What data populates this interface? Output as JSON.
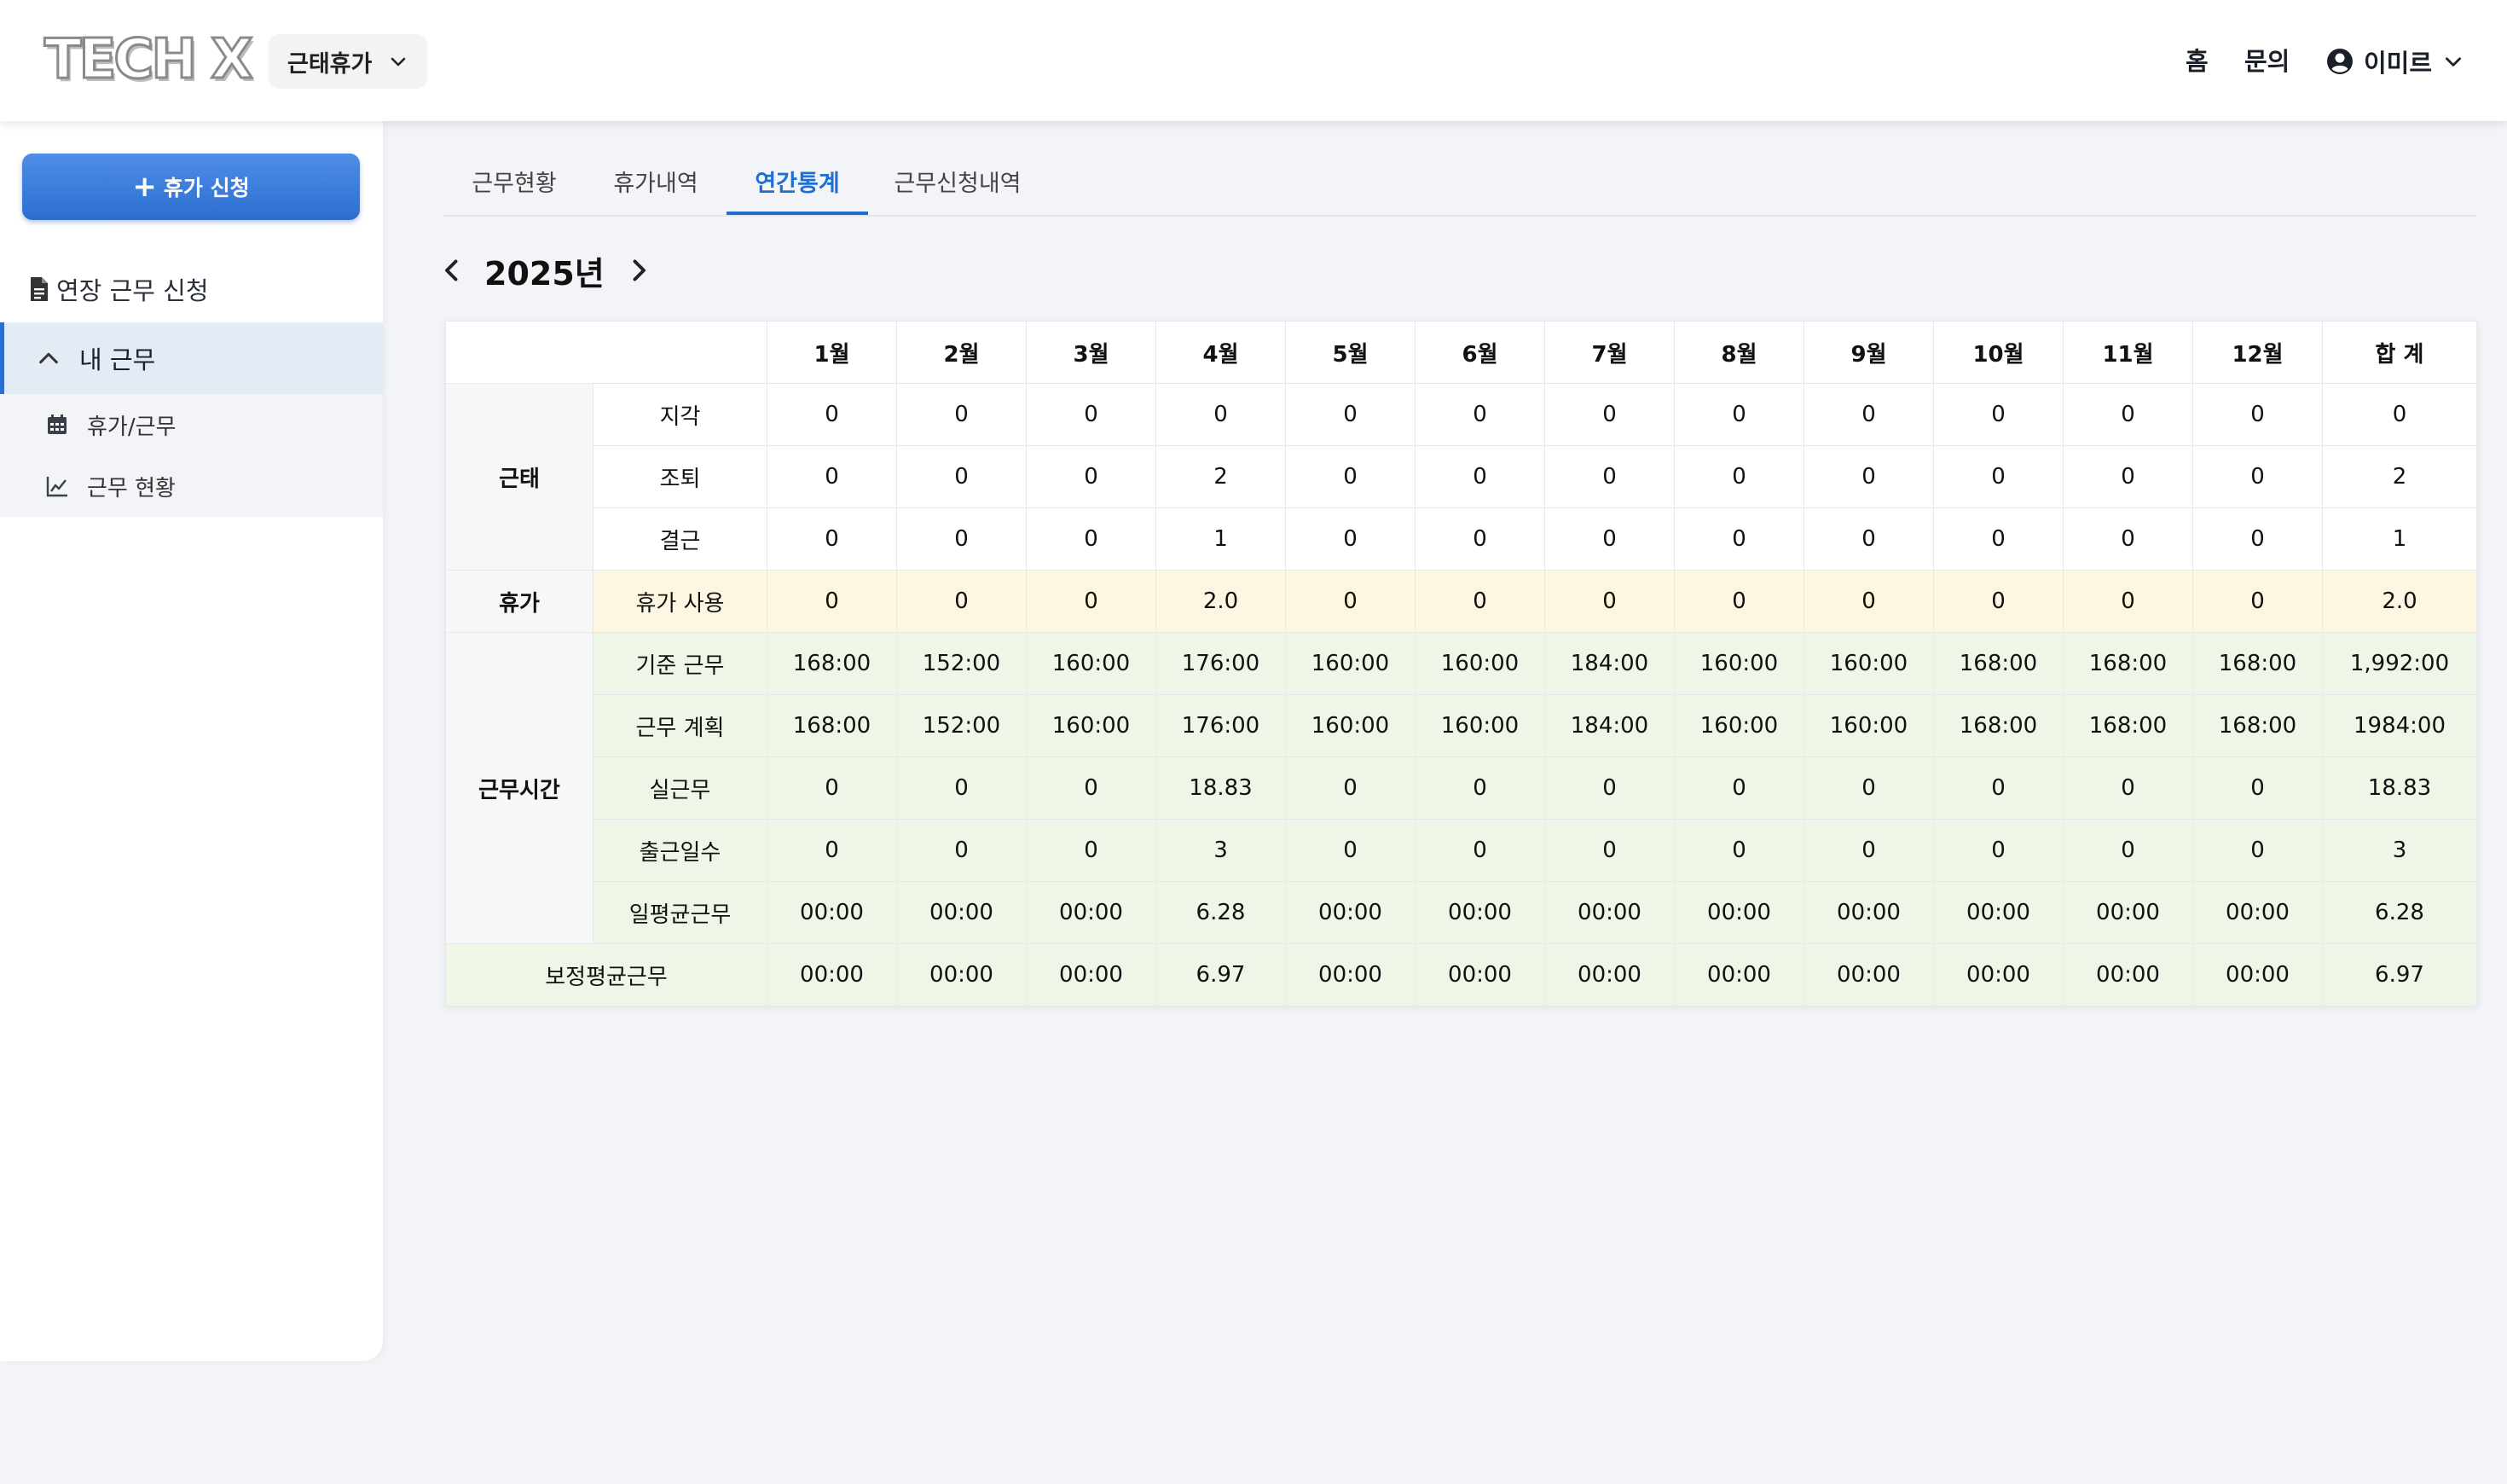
{
  "header": {
    "logo": "TECH X",
    "module": "근태휴가",
    "nav_home": "홈",
    "nav_inquiry": "문의",
    "user_name": "이미르"
  },
  "sidebar": {
    "request_button": "휴가 신청",
    "overtime_link": "연장 근무 신청",
    "group_label": "내 근무",
    "sub_items": [
      "휴가/근무",
      "근무 현황"
    ]
  },
  "tabs": [
    "근무현황",
    "휴가내역",
    "연간통계",
    "근무신청내역"
  ],
  "active_tab": "연간통계",
  "year": "2025년",
  "table": {
    "columns": [
      "1월",
      "2월",
      "3월",
      "4월",
      "5월",
      "6월",
      "7월",
      "8월",
      "9월",
      "10월",
      "11월",
      "12월",
      "합 계"
    ],
    "groups": [
      {
        "name": "근태",
        "rows": [
          {
            "label": "지각",
            "values": [
              "0",
              "0",
              "0",
              "0",
              "0",
              "0",
              "0",
              "0",
              "0",
              "0",
              "0",
              "0",
              "0"
            ]
          },
          {
            "label": "조퇴",
            "values": [
              "0",
              "0",
              "0",
              "2",
              "0",
              "0",
              "0",
              "0",
              "0",
              "0",
              "0",
              "0",
              "2"
            ]
          },
          {
            "label": "결근",
            "values": [
              "0",
              "0",
              "0",
              "1",
              "0",
              "0",
              "0",
              "0",
              "0",
              "0",
              "0",
              "0",
              "1"
            ]
          }
        ]
      },
      {
        "name": "휴가",
        "rows": [
          {
            "label": "휴가 사용",
            "values": [
              "0",
              "0",
              "0",
              "2.0",
              "0",
              "0",
              "0",
              "0",
              "0",
              "0",
              "0",
              "0",
              "2.0"
            ]
          }
        ]
      },
      {
        "name": "근무시간",
        "rows": [
          {
            "label": "기준 근무",
            "values": [
              "168:00",
              "152:00",
              "160:00",
              "176:00",
              "160:00",
              "160:00",
              "184:00",
              "160:00",
              "160:00",
              "168:00",
              "168:00",
              "168:00",
              "1,992:00"
            ]
          },
          {
            "label": "근무 계획",
            "values": [
              "168:00",
              "152:00",
              "160:00",
              "176:00",
              "160:00",
              "160:00",
              "184:00",
              "160:00",
              "160:00",
              "168:00",
              "168:00",
              "168:00",
              "1984:00"
            ]
          },
          {
            "label": "실근무",
            "values": [
              "0",
              "0",
              "0",
              "18.83",
              "0",
              "0",
              "0",
              "0",
              "0",
              "0",
              "0",
              "0",
              "18.83"
            ]
          },
          {
            "label": "출근일수",
            "values": [
              "0",
              "0",
              "0",
              "3",
              "0",
              "0",
              "0",
              "0",
              "0",
              "0",
              "0",
              "0",
              "3"
            ]
          },
          {
            "label": "일평균근무",
            "values": [
              "00:00",
              "00:00",
              "00:00",
              "6.28",
              "00:00",
              "00:00",
              "00:00",
              "00:00",
              "00:00",
              "00:00",
              "00:00",
              "00:00",
              "6.28"
            ]
          }
        ]
      }
    ],
    "footer_row": {
      "label": "보정평균근무",
      "values": [
        "00:00",
        "00:00",
        "00:00",
        "6.97",
        "00:00",
        "00:00",
        "00:00",
        "00:00",
        "00:00",
        "00:00",
        "00:00",
        "00:00",
        "6.97"
      ]
    }
  }
}
